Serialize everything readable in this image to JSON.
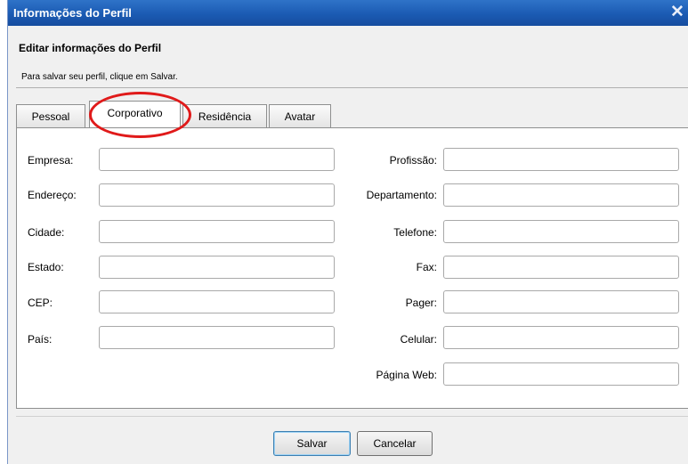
{
  "window": {
    "title": "Informações do Perfil",
    "close_glyph": "✕"
  },
  "header": {
    "heading": "Editar informações do Perfil",
    "subtitle": "Para salvar seu perfil, clique em Salvar."
  },
  "tabs": [
    {
      "label": "Pessoal",
      "active": false
    },
    {
      "label": "Corporativo",
      "active": true
    },
    {
      "label": "Residência",
      "active": false
    },
    {
      "label": "Avatar",
      "active": false
    }
  ],
  "form": {
    "left": [
      {
        "label": "Empresa:",
        "value": ""
      },
      {
        "label": "Endereço:",
        "value": ""
      },
      {
        "label": "Cidade:",
        "value": ""
      },
      {
        "label": "Estado:",
        "value": ""
      },
      {
        "label": "CEP:",
        "value": ""
      },
      {
        "label": "País:",
        "value": ""
      }
    ],
    "right": [
      {
        "label": "Profissão:",
        "value": ""
      },
      {
        "label": "Departamento:",
        "value": ""
      },
      {
        "label": "Telefone:",
        "value": ""
      },
      {
        "label": "Fax:",
        "value": ""
      },
      {
        "label": "Pager:",
        "value": ""
      },
      {
        "label": "Celular:",
        "value": ""
      },
      {
        "label": "Página Web:",
        "value": ""
      }
    ]
  },
  "buttons": {
    "save": "Salvar",
    "cancel": "Cancelar"
  },
  "colors": {
    "titlebar": "#1b5bb3",
    "highlight": "#e01a1a"
  }
}
